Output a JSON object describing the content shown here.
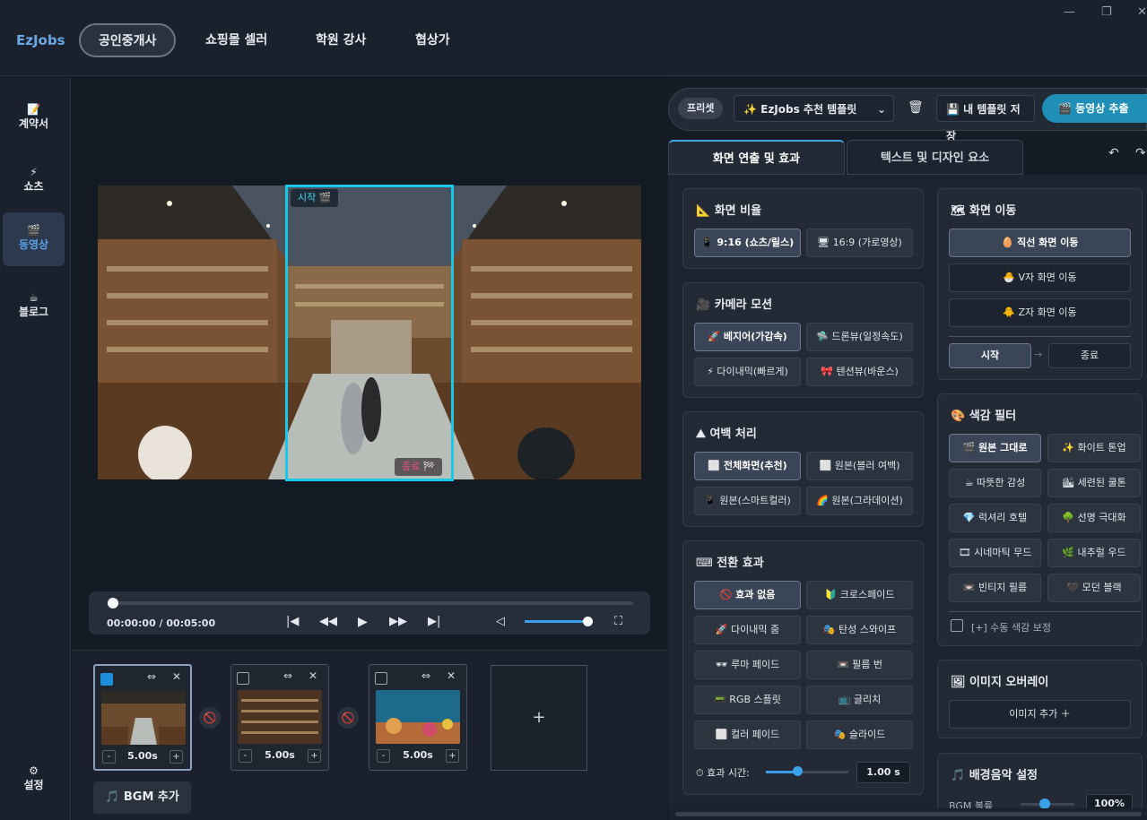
{
  "app": {
    "logo": "EzJobs",
    "tabs": [
      "공인중개사",
      "쇼핑몰 셀러",
      "학원 강사",
      "협상가"
    ],
    "window_controls": [
      "—",
      "❐",
      "✕"
    ]
  },
  "sidebar": {
    "items": [
      {
        "icon": "📝",
        "label": "계약서"
      },
      {
        "icon": "⚡",
        "label": "쇼츠"
      },
      {
        "icon": "🎬",
        "label": "동영상"
      },
      {
        "icon": "☕",
        "label": "블로그"
      }
    ],
    "settings": {
      "icon": "⚙",
      "label": "설정"
    }
  },
  "preview": {
    "start_label": "시작 🎬",
    "end_label": "종료 🏁"
  },
  "player": {
    "time": "00:00:00 / 00:05:00",
    "progress": 0,
    "volume": 0.95
  },
  "timeline": {
    "clips": [
      {
        "duration": "5.00s",
        "selected": true
      },
      {
        "duration": "5.00s",
        "selected": false
      },
      {
        "duration": "5.00s",
        "selected": false
      }
    ],
    "add": "+",
    "bgm_label": "🎵 BGM 추가"
  },
  "preset": {
    "label": "프리셋",
    "selected": "✨ EzJobs 추천 템플릿",
    "delete_icon": "🗑",
    "save": "💾 내 템플릿 저장",
    "export": "🎬 동영상 추출"
  },
  "panel_tabs": [
    "화면 연출 및 효과",
    "텍스트 및 디자인 요소"
  ],
  "undo": "↶",
  "redo": "↷",
  "aspect": {
    "title": "📐 화면 비율",
    "options": [
      "📱 9:16 (쇼츠/릴스)",
      "🖥 16:9 (가로영상)"
    ]
  },
  "camera": {
    "title": "🎥 카메라 모션",
    "options": [
      "🚀 베지어(가감속)",
      "🛸 드론뷰(일정속도)",
      "⚡ 다이내믹(빠르게)",
      "🎀 텐션뷰(바운스)"
    ]
  },
  "margin": {
    "title": "⛰ 여백 처리",
    "options": [
      "⬜ 전체화면(추천)",
      "⬜ 원본(블러 여백)",
      "📱 원본(스마트컬러)",
      "🌈 원본(그라데이션)"
    ]
  },
  "transition": {
    "title": "⌨ 전환 효과",
    "options": [
      "🚫 효과 없음",
      "🔰 크로스페이드",
      "🚀 다이내믹 줌",
      "🎭 탄성 스와이프",
      "🕶 루마 페이드",
      "📼 필름 번",
      "📟 RGB 스플릿",
      "📺 글리치",
      "⬜ 컬러 페이드",
      "🎭 슬라이드"
    ],
    "duration_label": "⏱ 효과 시간:",
    "duration_value": "1.00 s",
    "duration_fraction": 0.38
  },
  "motion": {
    "title": "🗺 화면 이동",
    "options": [
      "🥚 직선 화면 이동",
      "🐣 V자 화면 이동",
      "🐥 Z자 화면 이동"
    ],
    "start": "시작",
    "arrow": "→",
    "end": "종료"
  },
  "color": {
    "title": "🎨 색감 필터",
    "options": [
      "🎬 원본 그대로",
      "✨ 화이트 톤업",
      "☕ 따뜻한 감성",
      "🏙 세련된 쿨톤",
      "💎 럭셔리 호텔",
      "🌳 선명 극대화",
      "🎞 시네마틱 무드",
      "🌿 내추럴 우드",
      "📼 빈티지 필름",
      "🖤 모던 블랙"
    ],
    "manual": "[+] 수동 색감 보정"
  },
  "overlay": {
    "title": "🖼 이미지 오버레이",
    "add": "이미지 추가 ＋"
  },
  "bgm": {
    "title": "🎵 배경음악 설정",
    "ratio_label": "BGM 볼륨",
    "ratio_value": "100%"
  }
}
